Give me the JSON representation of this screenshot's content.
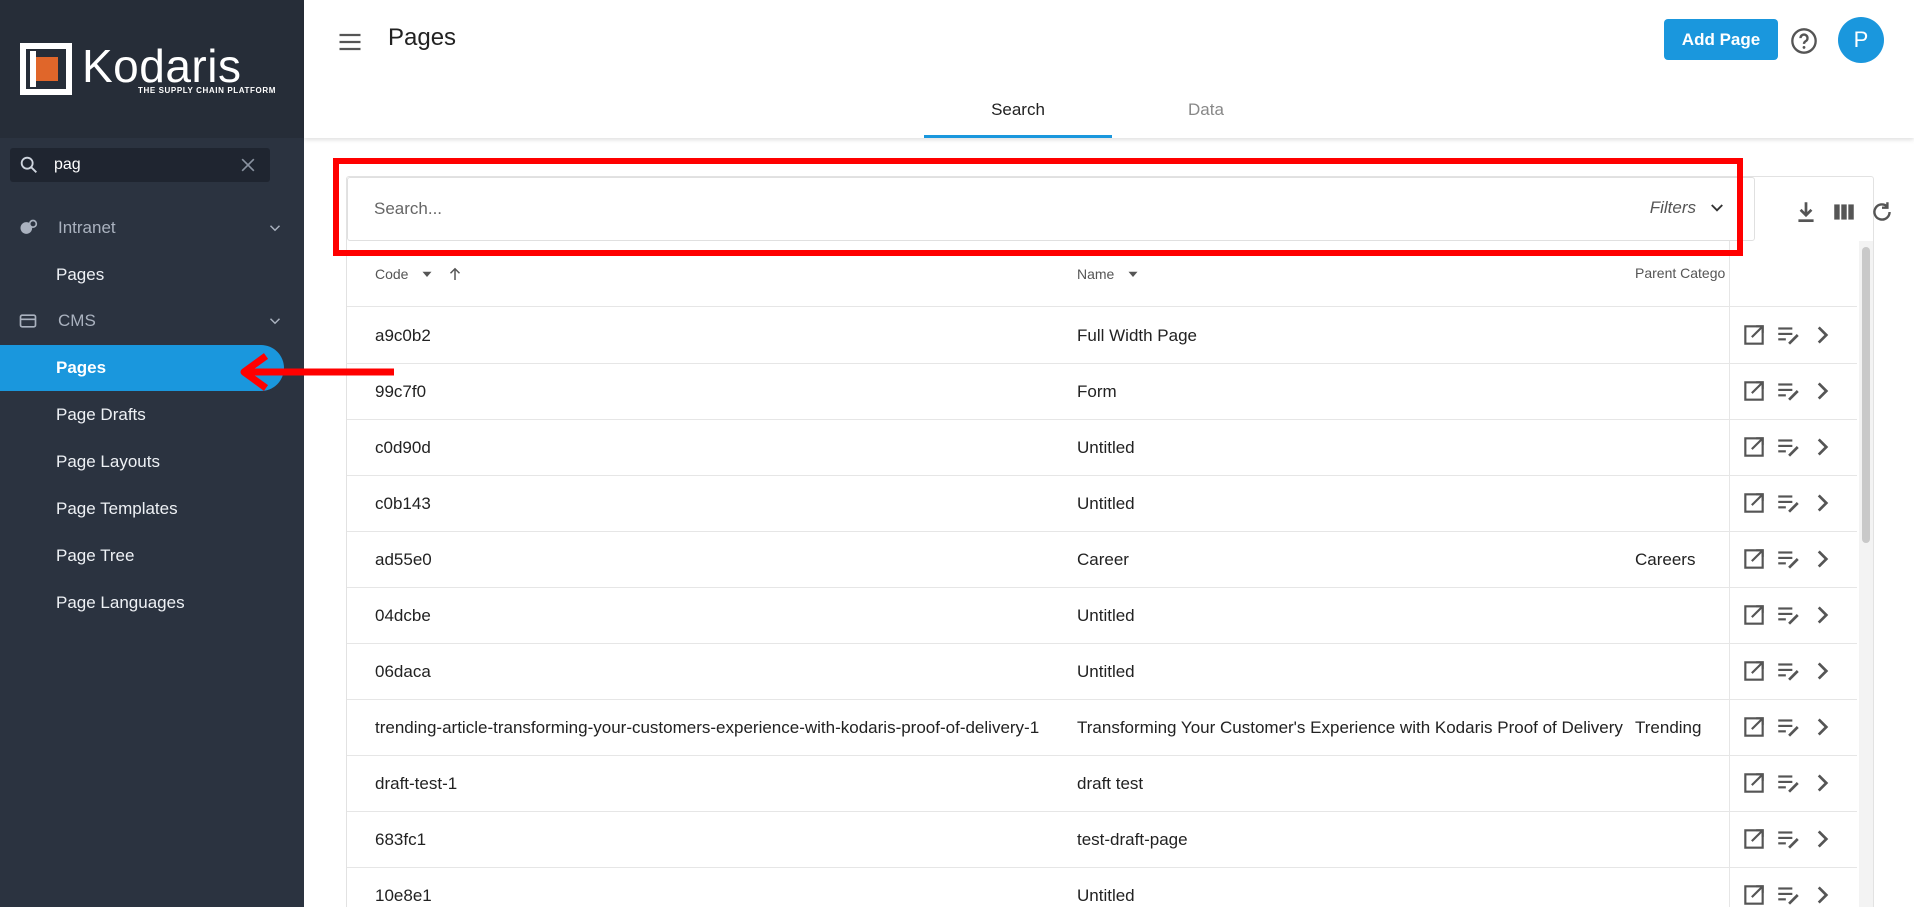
{
  "brand": {
    "name": "Kodaris",
    "tagline": "THE SUPPLY CHAIN PLATFORM"
  },
  "sidebar": {
    "search_value": "pag",
    "groups": [
      {
        "label": "Intranet",
        "icon": "globe-gear-icon",
        "items": [
          {
            "label": "Pages",
            "active": false
          }
        ]
      },
      {
        "label": "CMS",
        "icon": "browser-window-icon",
        "items": [
          {
            "label": "Pages",
            "active": true
          },
          {
            "label": "Page Drafts",
            "active": false
          },
          {
            "label": "Page Layouts",
            "active": false
          },
          {
            "label": "Page Templates",
            "active": false
          },
          {
            "label": "Page Tree",
            "active": false
          },
          {
            "label": "Page Languages",
            "active": false
          }
        ]
      }
    ]
  },
  "header": {
    "title": "Pages",
    "add_button": "Add Page",
    "avatar_initial": "P"
  },
  "tabs": [
    {
      "label": "Search",
      "active": true
    },
    {
      "label": "Data",
      "active": false
    }
  ],
  "search": {
    "placeholder": "Search...",
    "filters_label": "Filters"
  },
  "table": {
    "columns": [
      "Code",
      "Name",
      "Parent Catego"
    ],
    "rows": [
      {
        "code": "a9c0b2",
        "name": "Full Width Page",
        "parent": ""
      },
      {
        "code": "99c7f0",
        "name": "Form",
        "parent": ""
      },
      {
        "code": "c0d90d",
        "name": "Untitled",
        "parent": ""
      },
      {
        "code": "c0b143",
        "name": "Untitled",
        "parent": ""
      },
      {
        "code": "ad55e0",
        "name": "Career",
        "parent": "Careers"
      },
      {
        "code": "04dcbe",
        "name": "Untitled",
        "parent": ""
      },
      {
        "code": "06daca",
        "name": "Untitled",
        "parent": ""
      },
      {
        "code": "trending-article-transforming-your-customers-experience-with-kodaris-proof-of-delivery-1",
        "name": "Transforming Your Customer's Experience with Kodaris Proof of Delivery",
        "parent": "Trending"
      },
      {
        "code": "draft-test-1",
        "name": "draft test",
        "parent": ""
      },
      {
        "code": "683fc1",
        "name": "test-draft-page",
        "parent": ""
      },
      {
        "code": "10e8e1",
        "name": "Untitled",
        "parent": ""
      }
    ]
  },
  "colors": {
    "accent": "#1a97dd",
    "sidebar_bg": "#2b3340",
    "highlight": "#ff0000",
    "logo_orange": "#e0662a"
  }
}
